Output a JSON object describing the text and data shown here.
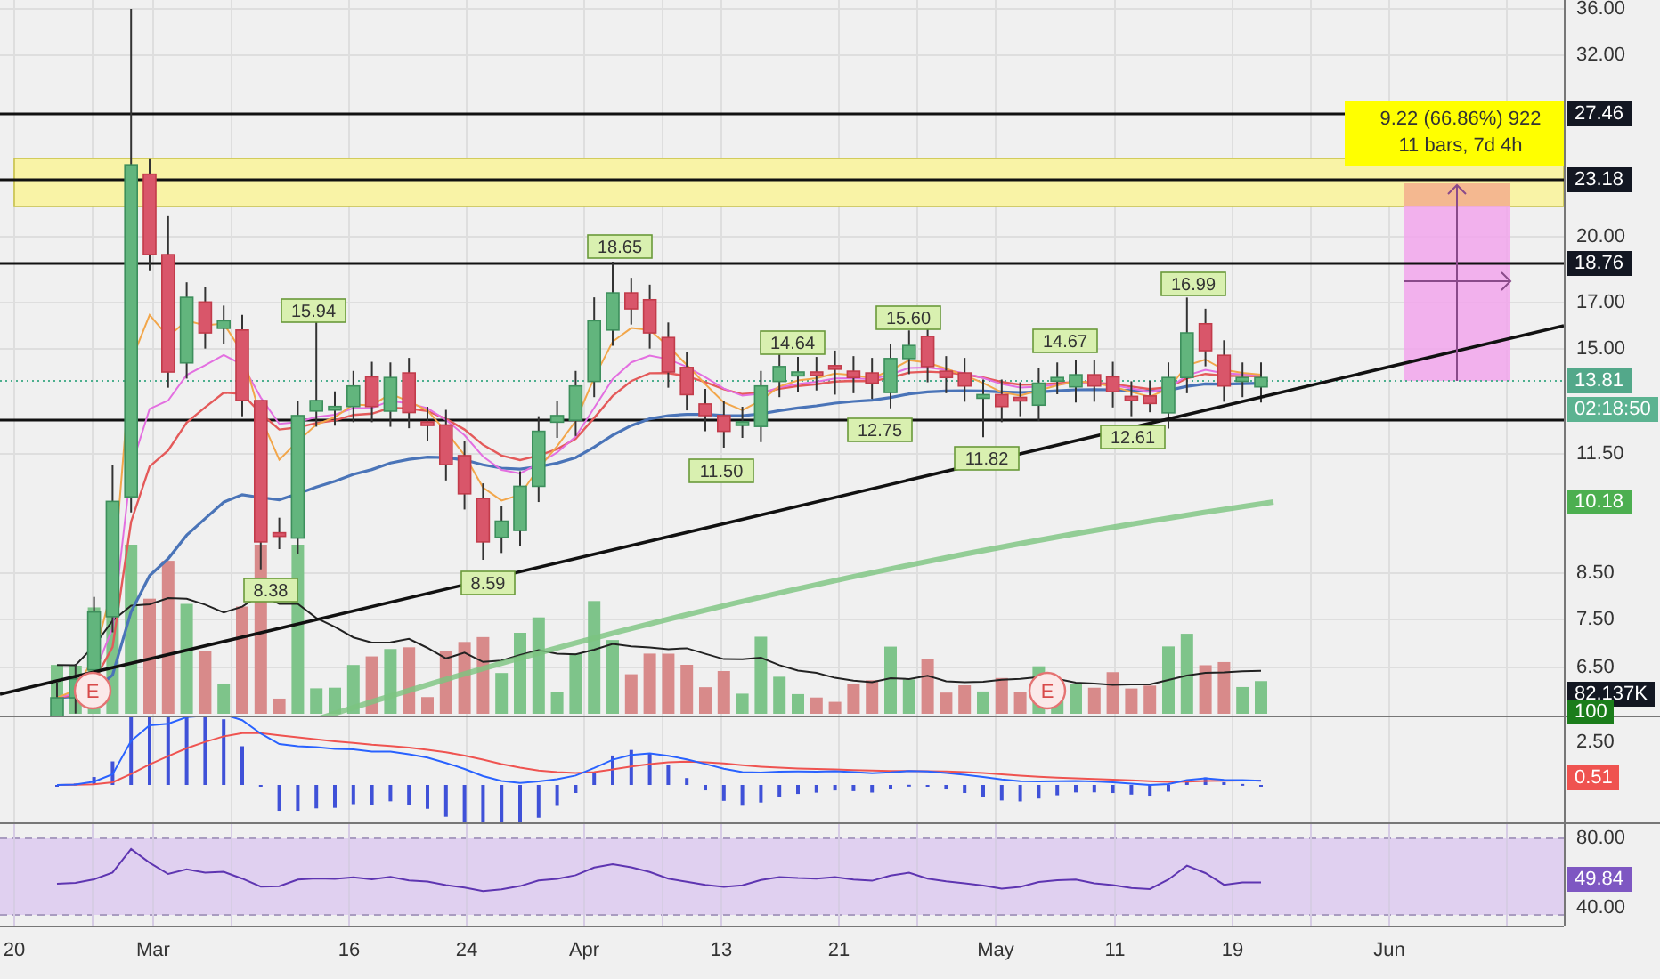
{
  "price_axis": {
    "ticks": [
      "36.00",
      "32.00",
      "20.00",
      "17.00",
      "15.00",
      "11.50",
      "8.50",
      "7.50",
      "6.50"
    ]
  },
  "price_tags": [
    {
      "text": "27.46",
      "color": "#131722"
    },
    {
      "text": "23.18",
      "color": "#131722"
    },
    {
      "text": "18.76",
      "color": "#131722"
    },
    {
      "text": "13.81",
      "color": "#53a88a"
    },
    {
      "text": "02:18:50",
      "color": "#5cb391"
    },
    {
      "text": "10.18",
      "color": "#4caf50"
    },
    {
      "text": "82.137K",
      "color": "#131722"
    },
    {
      "text": "100",
      "color": "#1b7d1b"
    }
  ],
  "price_labels": [
    "15.94",
    "8.38",
    "18.65",
    "8.59",
    "14.64",
    "11.50",
    "12.75",
    "15.60",
    "11.82",
    "14.67",
    "12.61",
    "16.99"
  ],
  "measure": {
    "change": "9.22 (66.86%) 922",
    "duration": "11 bars, 7d 4h"
  },
  "earnings_markers": [
    "E",
    "E"
  ],
  "macd": {
    "ticks": [
      "2.50"
    ],
    "tags": [
      {
        "text": "0.51",
        "color": "#ef5350"
      }
    ]
  },
  "rsi": {
    "ticks": [
      "80.00",
      "40.00"
    ],
    "tags": [
      {
        "text": "49.84",
        "color": "#7e57c2"
      }
    ]
  },
  "time_axis": {
    "labels": [
      "20",
      "Mar",
      "16",
      "24",
      "Apr",
      "13",
      "21",
      "May",
      "11",
      "19",
      "Jun"
    ]
  }
}
